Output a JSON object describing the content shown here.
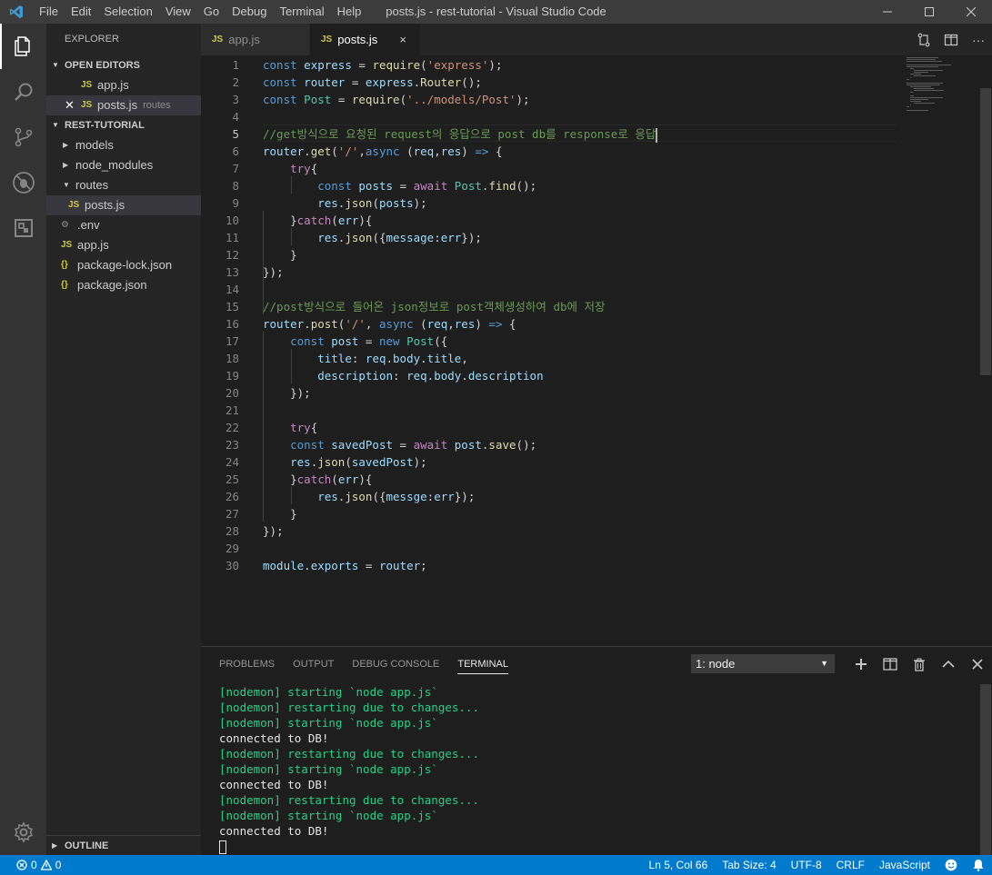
{
  "window": {
    "title": "posts.js - rest-tutorial - Visual Studio Code",
    "menu": [
      "File",
      "Edit",
      "Selection",
      "View",
      "Go",
      "Debug",
      "Terminal",
      "Help"
    ]
  },
  "sidebar": {
    "header": "EXPLORER",
    "open_editors_label": "OPEN EDITORS",
    "open_editors": [
      {
        "icon": "JS",
        "name": "app.js",
        "detail": ""
      },
      {
        "icon": "JS",
        "name": "posts.js",
        "detail": "routes"
      }
    ],
    "project_label": "REST-TUTORIAL",
    "tree": [
      {
        "type": "folder",
        "name": "models"
      },
      {
        "type": "folder",
        "name": "node_modules"
      },
      {
        "type": "folder",
        "name": "routes"
      },
      {
        "type": "file",
        "icon": "JS",
        "name": "posts.js"
      },
      {
        "type": "file",
        "icon": "gear",
        "name": ".env"
      },
      {
        "type": "file",
        "icon": "JS",
        "name": "app.js"
      },
      {
        "type": "file",
        "icon": "{}",
        "name": "package-lock.json"
      },
      {
        "type": "file",
        "icon": "{}",
        "name": "package.json"
      }
    ],
    "outline_label": "OUTLINE"
  },
  "tabs": [
    {
      "icon": "JS",
      "label": "app.js"
    },
    {
      "icon": "JS",
      "label": "posts.js",
      "close": "×"
    }
  ],
  "editor": {
    "current_line": 5,
    "lines": [
      "const express = require('express');",
      "const router = express.Router();",
      "const Post = require('../models/Post');",
      "",
      "//get방식으로 요청된 request의 응답으로 post db를 response로 응답",
      "router.get('/',async (req,res) => {",
      "    try{",
      "        const posts = await Post.find();",
      "        res.json(posts);",
      "    }catch(err){",
      "        res.json({message:err});",
      "    }",
      "});",
      "",
      "//post방식으로 들어온 json정보로 post객체생성하여 db에 저장",
      "router.post('/', async (req,res) => {",
      "    const post = new Post({",
      "        title: req.body.title,",
      "        description: req.body.description",
      "    });",
      "",
      "    try{",
      "    const savedPost = await post.save();",
      "    res.json(savedPost);",
      "    }catch(err){",
      "        res.json({messge:err});",
      "    }",
      "});",
      "",
      "module.exports = router;"
    ]
  },
  "panel": {
    "tabs": [
      "PROBLEMS",
      "OUTPUT",
      "DEBUG CONSOLE",
      "TERMINAL"
    ],
    "active_tab": "TERMINAL",
    "terminal_select": "1: node",
    "terminal_lines": [
      {
        "text": "[nodemon] starting `node app.js`",
        "color": "green"
      },
      {
        "text": "[nodemon] restarting due to changes...",
        "color": "green"
      },
      {
        "text": "[nodemon] starting `node app.js`",
        "color": "green"
      },
      {
        "text": "connected to DB!",
        "color": "white"
      },
      {
        "text": "[nodemon] restarting due to changes...",
        "color": "green"
      },
      {
        "text": "[nodemon] starting `node app.js`",
        "color": "green"
      },
      {
        "text": "connected to DB!",
        "color": "white"
      },
      {
        "text": "[nodemon] restarting due to changes...",
        "color": "green"
      },
      {
        "text": "[nodemon] starting `node app.js`",
        "color": "green"
      },
      {
        "text": "connected to DB!",
        "color": "white"
      }
    ]
  },
  "statusbar": {
    "errors": "0",
    "warnings": "0",
    "position": "Ln 5, Col 66",
    "tab_size": "Tab Size: 4",
    "encoding": "UTF-8",
    "eol": "CRLF",
    "language": "JavaScript"
  },
  "colors": {
    "accent": "#007acc",
    "activity_bar": "#333333",
    "sidebar": "#252526",
    "editor": "#1e1e1e",
    "terminal_green": "#23d18b"
  }
}
